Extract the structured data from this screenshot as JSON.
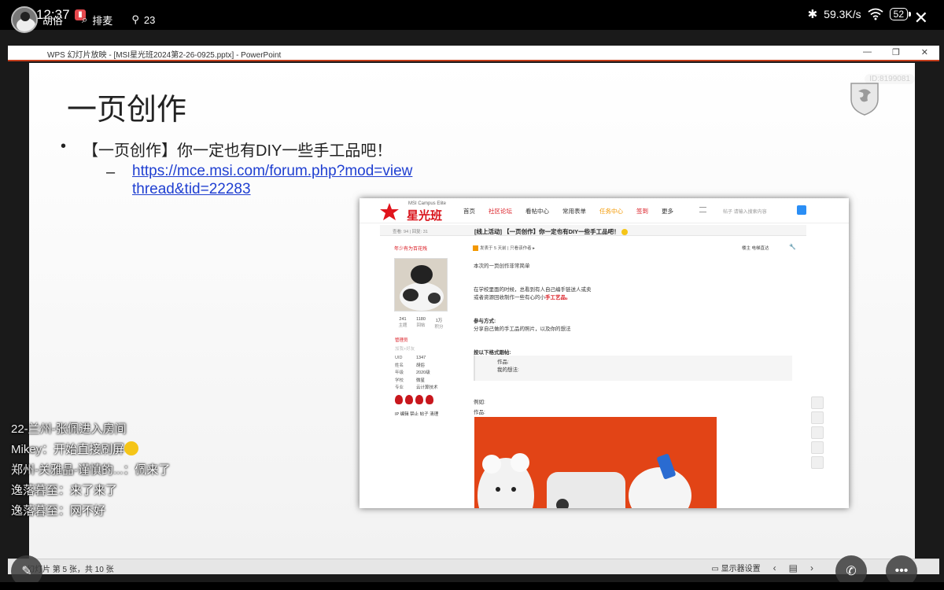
{
  "status_bar": {
    "time": "12:37",
    "network_speed": "59.3K/s",
    "battery": "52"
  },
  "overlay": {
    "user1": "胡俗",
    "user2": "排麦",
    "count": "23"
  },
  "ppt": {
    "window_title": "WPS 幻灯片放映 - [MSI星光班2024第2-26-0925.pptx] - PowerPoint",
    "watermark": "ID:8199081",
    "slide_title": "一页创作",
    "bullet": "【一页创作】你一定也有DIY一些手工品吧！",
    "dash": "–",
    "link": "https://mce.msi.com/forum.php?mod=viewthread&tid=22283",
    "status_left": "幻灯片 第 5 张，共 10 张",
    "display_settings": "显示器设置"
  },
  "forum": {
    "brand_small": "MSI Campus Elite",
    "brand": "星光班",
    "menu": [
      "首页",
      "社区论坛",
      "看帖中心",
      "常用表单",
      "任务中心",
      "签到",
      "更多"
    ],
    "search_label": "帖子  请输入搜索内容",
    "stats": "查看: 94 | 回复: 31",
    "thread_title": "[线上活动] 【一页创作】你一定也有DIY一些手工品吧！",
    "side_name": "年少有为百花残",
    "counts": [
      {
        "value": "241",
        "label": "主题"
      },
      {
        "value": "1180",
        "label": "回帖"
      },
      {
        "value": "1万",
        "label": "积分"
      }
    ],
    "role": "管理员",
    "role2": "加我+好友",
    "info": [
      {
        "k": "UID",
        "v": "1347"
      },
      {
        "k": "姓名",
        "v": "胡俗"
      },
      {
        "k": "年级",
        "v": "2020级"
      },
      {
        "k": "学校",
        "v": "微星"
      },
      {
        "k": "专业",
        "v": "云计算技术"
      }
    ],
    "actions": "IP  编辑  禁止  帖子  清理",
    "post_meta": "发表于 5 天前  |  只看该作者 ▸",
    "floor": "楼主   电梯直达",
    "body_intro": "本次的一页创作非常简单",
    "body_line1": "在学校里面的时候，总看到有人自己编手链送人或卖",
    "body_line2_prefix": "或者资源回收制作一些有心的小",
    "body_line2_red": "手工艺品。",
    "how_title": "参与方式:",
    "how_text": "分享自己做的手工品的照片，以及你的想法",
    "format_title": "按以下格式跟帖:",
    "quote_line1": "作品:",
    "quote_line2": "我的想法:",
    "example_line1": "例如:",
    "example_line2": "作品:"
  },
  "chat": [
    {
      "name": "22-兰州-张佩进入房间",
      "msg": ""
    },
    {
      "name": "Mikey：",
      "msg": "开始直接刷屏"
    },
    {
      "name": "郑州-关雅晶-谨慎的...：",
      "msg": "佩来了"
    },
    {
      "name": "逸落暮至：",
      "msg": "来了来了"
    },
    {
      "name": "逸落暮至：",
      "msg": "网不好"
    }
  ]
}
